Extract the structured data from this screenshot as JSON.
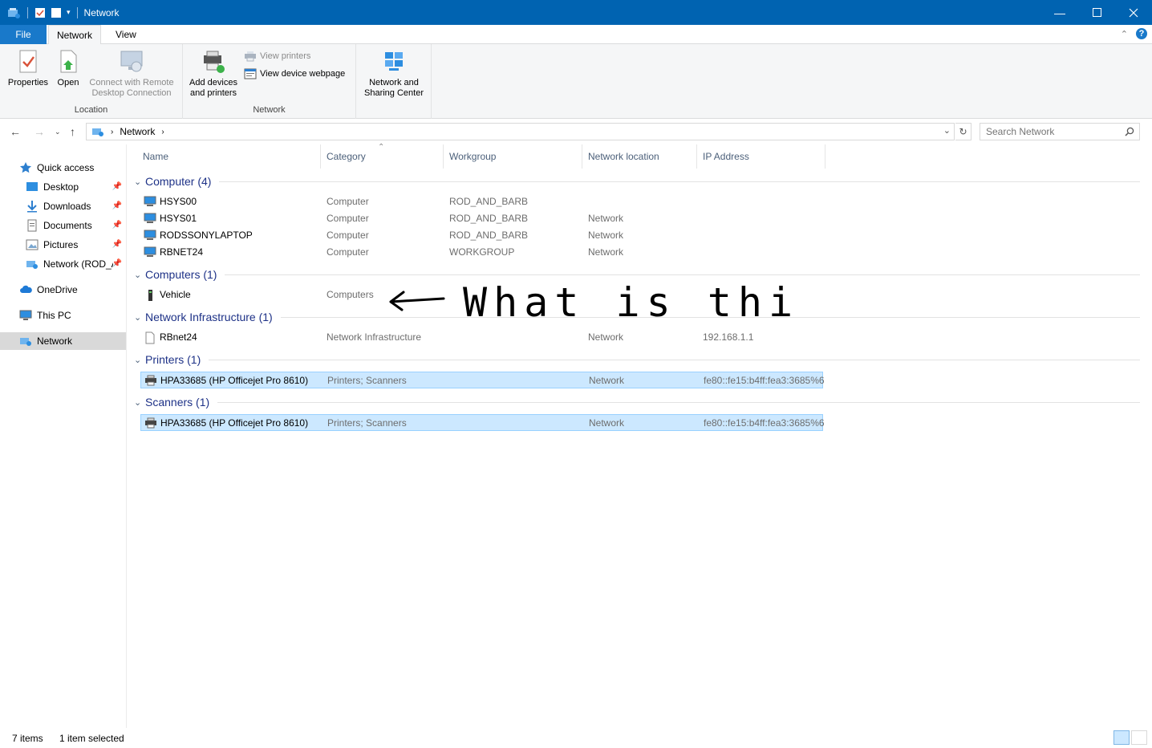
{
  "window": {
    "title": "Network"
  },
  "tabs": {
    "file": "File",
    "network": "Network",
    "view": "View"
  },
  "ribbon": {
    "location": {
      "label": "Location",
      "properties": "Properties",
      "open": "Open",
      "remote_line1": "Connect with Remote",
      "remote_line2": "Desktop Connection"
    },
    "network": {
      "label": "Network",
      "add_line1": "Add devices",
      "add_line2": "and printers",
      "view_printers": "View printers",
      "view_webpage": "View device webpage"
    },
    "sharing": {
      "line1": "Network and",
      "line2": "Sharing Center"
    }
  },
  "address": {
    "crumb": "Network",
    "search_placeholder": "Search Network"
  },
  "nav": {
    "quick_access": "Quick access",
    "desktop": "Desktop",
    "downloads": "Downloads",
    "documents": "Documents",
    "pictures": "Pictures",
    "network_rod": "Network (ROD_AND_BARB)",
    "onedrive": "OneDrive",
    "this_pc": "This PC",
    "network": "Network"
  },
  "columns": {
    "name": "Name",
    "category": "Category",
    "workgroup": "Workgroup",
    "location": "Network location",
    "ip": "IP Address"
  },
  "groups": [
    {
      "label": "Computer (4)",
      "rows": [
        {
          "name": "HSYS00",
          "category": "Computer",
          "workgroup": "ROD_AND_BARB",
          "location": "",
          "ip": ""
        },
        {
          "name": "HSYS01",
          "category": "Computer",
          "workgroup": "ROD_AND_BARB",
          "location": "Network",
          "ip": ""
        },
        {
          "name": "RODSSONYLAPTOP",
          "category": "Computer",
          "workgroup": "ROD_AND_BARB",
          "location": "Network",
          "ip": ""
        },
        {
          "name": "RBNET24",
          "category": "Computer",
          "workgroup": "WORKGROUP",
          "location": "Network",
          "ip": ""
        }
      ]
    },
    {
      "label": "Computers (1)",
      "rows": [
        {
          "name": "Vehicle",
          "category": "Computers",
          "workgroup": "",
          "location": "",
          "ip": ""
        }
      ]
    },
    {
      "label": "Network Infrastructure (1)",
      "rows": [
        {
          "name": "RBnet24",
          "category": "Network Infrastructure",
          "workgroup": "",
          "location": "Network",
          "ip": "192.168.1.1"
        }
      ]
    },
    {
      "label": "Printers (1)",
      "rows": [
        {
          "name": "HPA33685 (HP Officejet Pro 8610)",
          "category": "Printers; Scanners",
          "workgroup": "",
          "location": "Network",
          "ip": "fe80::fe15:b4ff:fea3:3685%6"
        }
      ]
    },
    {
      "label": "Scanners (1)",
      "rows": [
        {
          "name": "HPA33685 (HP Officejet Pro 8610)",
          "category": "Printers; Scanners",
          "workgroup": "",
          "location": "Network",
          "ip": "fe80::fe15:b4ff:fea3:3685%6"
        }
      ]
    }
  ],
  "annotation": {
    "text": "What is this?"
  },
  "status": {
    "count": "7 items",
    "selected": "1 item selected"
  },
  "colors": {
    "titlebar": "#0063b1",
    "group_text": "#1e3287",
    "selection": "#cce8ff"
  },
  "icons": [
    "properties-icon",
    "open-icon",
    "remote-desktop-icon",
    "add-devices-icon",
    "network-sharing-icon",
    "computer-icon",
    "printer-icon",
    "device-icon",
    "file-icon",
    "network-folder-icon"
  ]
}
